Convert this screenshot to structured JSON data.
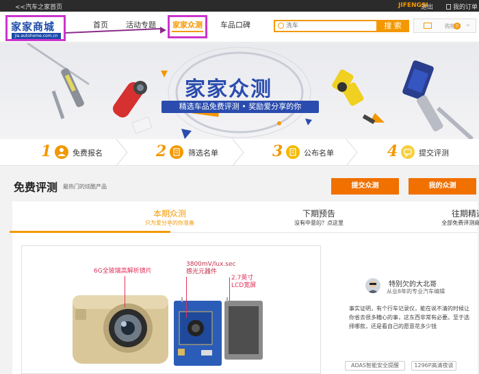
{
  "topbar": {
    "home_link": "<<汽车之家首页",
    "username": "JIFENGSI",
    "logout": "退出",
    "orders": "我的订单"
  },
  "logo": {
    "title": "家家商城",
    "url": "jia.autohome.com.cn"
  },
  "nav": {
    "items": [
      "首页",
      "活动专题",
      "家家众测",
      "车品口碑"
    ],
    "active": "家家众测"
  },
  "search": {
    "placeholder": "洗车",
    "button": "搜 索"
  },
  "cart": {
    "label": "购物车",
    "count": "0"
  },
  "banner": {
    "title": "家家众测",
    "subtitle": "精选车品免费评测 • 奖励爱分享的你"
  },
  "steps": [
    {
      "num": "1",
      "label": "免费报名",
      "icon": "user-icon"
    },
    {
      "num": "2",
      "label": "筛选名单",
      "icon": "list-icon"
    },
    {
      "num": "3",
      "label": "公布名单",
      "icon": "document-icon"
    },
    {
      "num": "4",
      "label": "提交评测",
      "icon": "chat-icon"
    }
  ],
  "section": {
    "title": "免费评测",
    "subtitle": "最热门的炫酷产品",
    "btn_submit": "提交众测",
    "btn_mine": "我的众测"
  },
  "tabs": [
    {
      "title": "本期众测",
      "sub": "只为爱分享的你准备"
    },
    {
      "title": "下期预告",
      "sub": "没有中意的？点这里"
    },
    {
      "title": "往期精选",
      "sub": "全部免费评测商品>>"
    }
  ],
  "product": {
    "labels": {
      "lens": "6G全玻璃高解析镜片",
      "sensor_line1": "3800mV/lux.sec",
      "sensor_line2": "感光元器件",
      "lcd_line1": "2.7英寸",
      "lcd_line2": "LCD宽屏"
    }
  },
  "reviewer": {
    "name": "特别欠的大北哥",
    "role": "从业8年的专业汽车编辑",
    "text": "事实证明，有个行车记录仪，能在说不清的时候让你省去很多糟心的事，这东西非常有必要。至于选择哪款，还是看自己的愿意花多少钱",
    "tags": [
      "ADAS智能安全提醒",
      "1296P高清夜谈"
    ]
  },
  "colors": {
    "accent": "#f39800",
    "brand_blue": "#2a4cae",
    "annotation": "#cc33cc"
  }
}
